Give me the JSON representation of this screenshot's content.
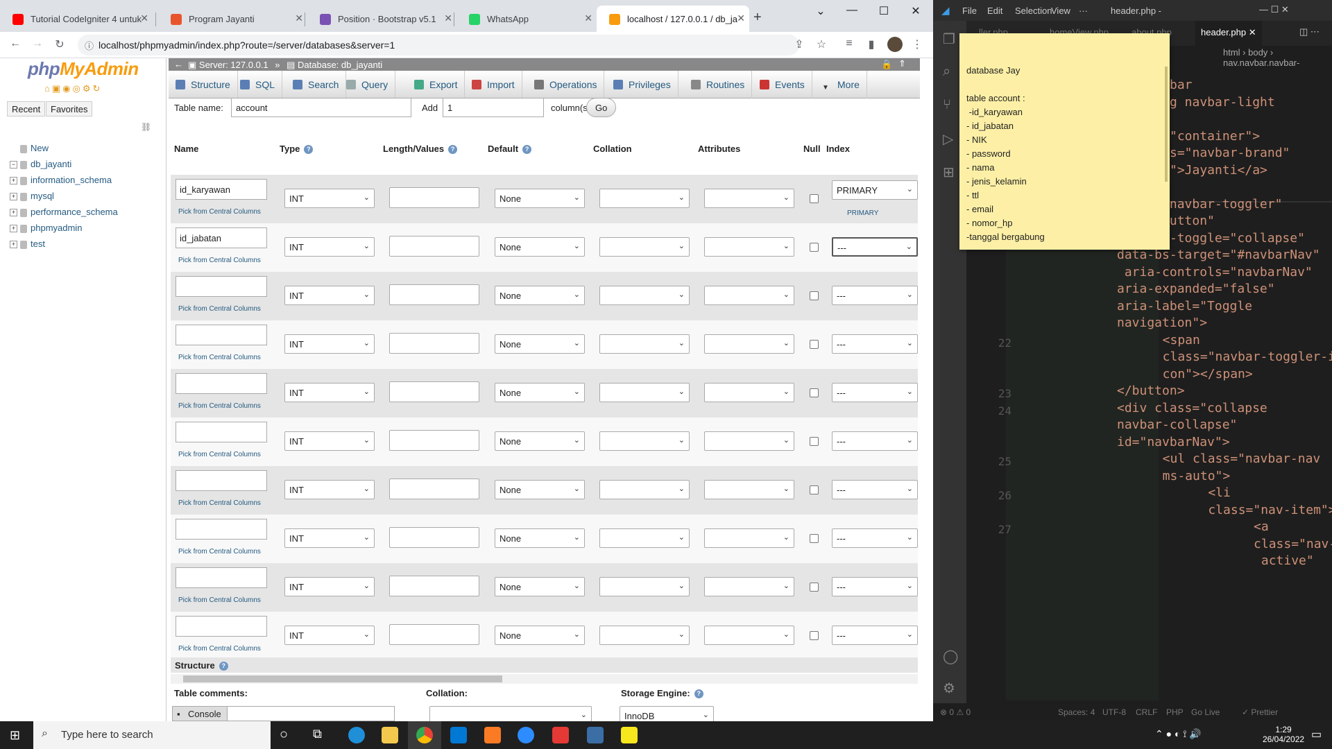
{
  "browser": {
    "tabs": [
      {
        "title": "Tutorial CodeIgniter 4 untuk",
        "color": "#ff0000",
        "active": false
      },
      {
        "title": "Program Jayanti",
        "color": "#e8552d",
        "active": false
      },
      {
        "title": "Position · Bootstrap v5.1",
        "color": "#7952b3",
        "active": false
      },
      {
        "title": "WhatsApp",
        "color": "#25d366",
        "active": false
      },
      {
        "title": "localhost / 127.0.0.1 / db_ja",
        "color": "#f89c0e",
        "active": true
      }
    ],
    "url": "localhost/phpmyadmin/index.php?route=/server/databases&server=1"
  },
  "pma": {
    "logo_php": "php",
    "logo_my": "MyAdmin",
    "recent": "Recent",
    "favorites": "Favorites",
    "tree": [
      {
        "label": "New",
        "expand": ""
      },
      {
        "label": "db_jayanti",
        "expand": "−"
      },
      {
        "label": "information_schema",
        "expand": "+"
      },
      {
        "label": "mysql",
        "expand": "+"
      },
      {
        "label": "performance_schema",
        "expand": "+"
      },
      {
        "label": "phpmyadmin",
        "expand": "+"
      },
      {
        "label": "test",
        "expand": "+"
      }
    ],
    "breadcrumb": {
      "server": "Server: 127.0.0.1",
      "sep": "»",
      "database": "Database: db_jayanti"
    },
    "menu": [
      "Structure",
      "SQL",
      "Search",
      "Query",
      "Export",
      "Import",
      "Operations",
      "Privileges",
      "Routines",
      "Events",
      "More"
    ],
    "table_name_label": "Table name:",
    "table_name": "account",
    "add_label": "Add",
    "add_value": "1",
    "columns_label": "column(s)",
    "go": "Go",
    "headers": {
      "name": "Name",
      "type": "Type",
      "length": "Length/Values",
      "default": "Default",
      "collation": "Collation",
      "attributes": "Attributes",
      "null": "Null",
      "index": "Index"
    },
    "pick": "Pick from Central Columns",
    "type": "INT",
    "default": "None",
    "index_none": "---",
    "index_primary": "PRIMARY",
    "index_primary_sub": "PRIMARY",
    "columns": [
      {
        "name": "id_karyawan"
      },
      {
        "name": "id_jabatan"
      },
      {
        "name": ""
      },
      {
        "name": ""
      },
      {
        "name": ""
      },
      {
        "name": ""
      },
      {
        "name": ""
      },
      {
        "name": ""
      },
      {
        "name": ""
      },
      {
        "name": ""
      }
    ],
    "structure_label": "Structure",
    "table_comments": "Table comments:",
    "collation_label": "Collation:",
    "storage_engine": "Storage Engine:",
    "engine": "InnoDB",
    "console": "Console"
  },
  "sticky": {
    "title": "database Jay",
    "subtitle": "table account :",
    "items": [
      " -id_karyawan",
      "- id_jabatan",
      "- NIK",
      "- password",
      "- nama",
      "- jenis_kelamin",
      "- ttl",
      "- email",
      "- nomor_hp",
      "-tanggal bergabung"
    ]
  },
  "vscode": {
    "menu": [
      "File",
      "Edit",
      "Selection",
      "View",
      "···"
    ],
    "title": "header.php -",
    "tabs": [
      "ller.php",
      "homeView.php",
      "about.php",
      "header.php"
    ],
    "breadcrumb": "html › body › nav.navbar.navbar-",
    "code": [
      {
        "t": "bar",
        "c": "#ce9178"
      },
      {
        "t": "g navbar-light",
        "c": "#ce9178"
      },
      {
        "t": "",
        "c": "#ce9178"
      },
      {
        "t": "\"container\">",
        "c": "#ce9178"
      },
      {
        "t": "s=\"navbar-brand\"",
        "c": "#ce9178"
      },
      {
        "t": "\">Jayanti</a>",
        "c": "#ce9178"
      },
      {
        "t": "",
        "c": "#ce9178"
      },
      {
        "t": "class=\"navbar-toggler\"",
        "c": "#ce9178"
      },
      {
        "t": "type=\"button\"",
        "c": "#ce9178"
      },
      {
        "t": "data-bs-toggle=\"collapse\"",
        "c": "#ce9178"
      },
      {
        "t": "data-bs-target=\"#navbarNav\"",
        "c": "#ce9178"
      },
      {
        "t": " aria-controls=\"navbarNav\"",
        "c": "#ce9178"
      },
      {
        "t": "aria-expanded=\"false\"",
        "c": "#ce9178"
      },
      {
        "t": "aria-label=\"Toggle",
        "c": "#ce9178"
      },
      {
        "t": "navigation\">",
        "c": "#ce9178"
      },
      {
        "t": "  <span",
        "c": "#ce9178"
      },
      {
        "t": "  class=\"navbar-toggler-i",
        "c": "#ce9178"
      },
      {
        "t": "  con\"></span>",
        "c": "#ce9178"
      },
      {
        "t": "</button>",
        "c": "#ce9178"
      },
      {
        "t": "<div class=\"collapse",
        "c": "#ce9178"
      },
      {
        "t": "navbar-collapse\"",
        "c": "#ce9178"
      },
      {
        "t": "id=\"navbarNav\">",
        "c": "#ce9178"
      },
      {
        "t": "  <ul class=\"navbar-nav",
        "c": "#ce9178"
      },
      {
        "t": "  ms-auto\">",
        "c": "#ce9178"
      },
      {
        "t": "    <li",
        "c": "#ce9178"
      },
      {
        "t": "    class=\"nav-item\">",
        "c": "#ce9178"
      },
      {
        "t": "      <a",
        "c": "#ce9178"
      },
      {
        "t": "      class=\"nav-link",
        "c": "#ce9178"
      },
      {
        "t": "       active\"",
        "c": "#ce9178"
      }
    ],
    "line_numbers": [
      {
        "n": "22",
        "row": 15
      },
      {
        "n": "23",
        "row": 18
      },
      {
        "n": "24",
        "row": 19
      },
      {
        "n": "25",
        "row": 22
      },
      {
        "n": "26",
        "row": 24
      },
      {
        "n": "27",
        "row": 26
      }
    ],
    "status": {
      "errors": "⊗ 0 ⚠ 0",
      "spaces": "Spaces: 4",
      "enc": "UTF-8",
      "eol": "CRLF",
      "lang": "PHP",
      "golive": "Go Live",
      "prettier": "✓ Prettier"
    }
  },
  "taskbar": {
    "search": "Type here to search",
    "time": "1:29",
    "date": "26/04/2022"
  }
}
